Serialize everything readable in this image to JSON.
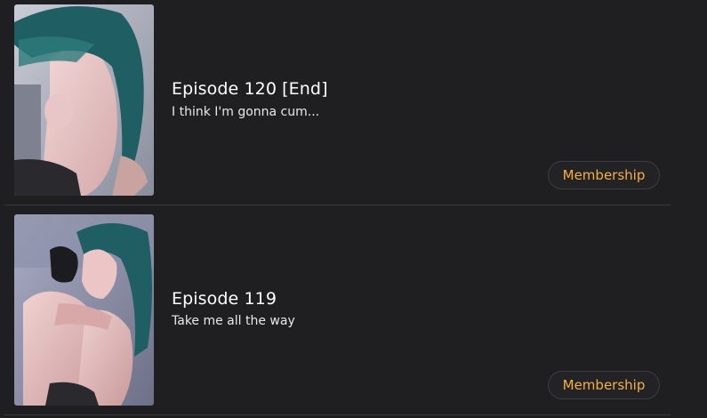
{
  "colors": {
    "background": "#1f1f21",
    "divider": "#3a3a3d",
    "title": "#ffffff",
    "subtitle": "#e8e8e8",
    "badge_text": "#f5b041",
    "badge_border": "#3d3d40"
  },
  "episodes": [
    {
      "title": "Episode 120 [End]",
      "subtitle": "I think I'm gonna cum...",
      "badge": "Membership",
      "thumbnail": "episode-120-cover"
    },
    {
      "title": "Episode 119",
      "subtitle": "Take me all the way",
      "badge": "Membership",
      "thumbnail": "episode-119-cover"
    }
  ]
}
